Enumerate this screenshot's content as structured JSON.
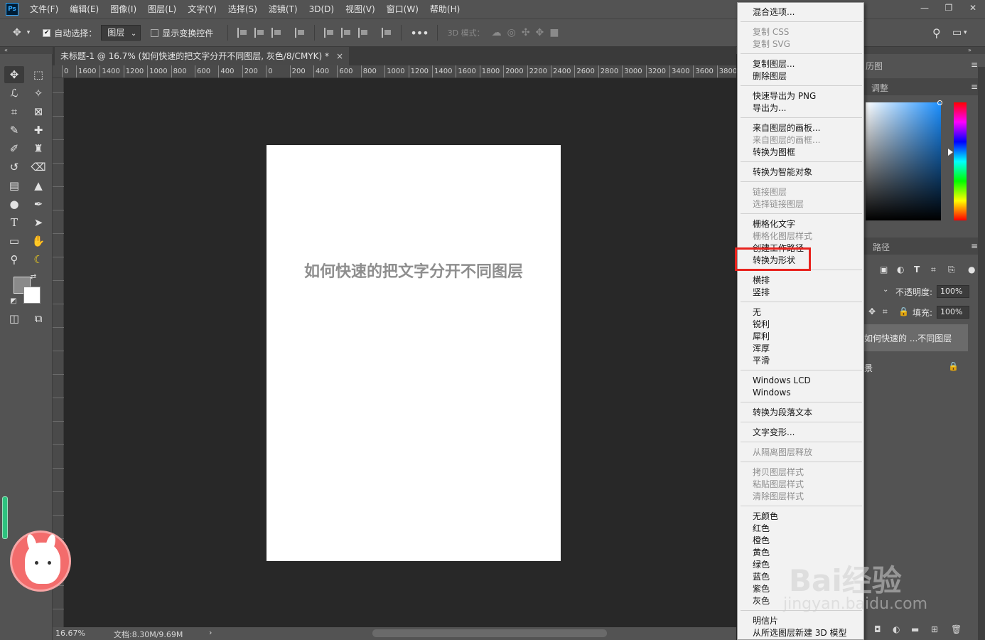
{
  "app": {
    "logo": "Ps"
  },
  "menubar": {
    "items": [
      "文件(F)",
      "编辑(E)",
      "图像(I)",
      "图层(L)",
      "文字(Y)",
      "选择(S)",
      "滤镜(T)",
      "3D(D)",
      "视图(V)",
      "窗口(W)",
      "帮助(H)"
    ]
  },
  "window_controls": {
    "minimize": "—",
    "restore": "❐",
    "close": "✕"
  },
  "optionsbar": {
    "auto_select_label": "自动选择：",
    "auto_select_value": "图层",
    "show_transform_label": "显示变换控件",
    "mode_3d_label": "3D 模式："
  },
  "document": {
    "tab_title": "未标题-1 @ 16.7% (如何快速的把文字分开不同图层, 灰色/8/CMYK) *",
    "close": "×",
    "text_layer_content": "如何快速的把文字分开不同图层"
  },
  "ruler": {
    "labels": [
      "0",
      "1600",
      "1400",
      "1200",
      "1000",
      "800",
      "600",
      "400",
      "200",
      "0",
      "200",
      "400",
      "600",
      "800",
      "1000",
      "1200",
      "1400",
      "1600",
      "1800",
      "2000",
      "2200",
      "2400",
      "2600",
      "2800",
      "3000",
      "3200",
      "3400",
      "3600",
      "3800"
    ]
  },
  "statusbar": {
    "zoom": "16.67%",
    "doc_size": "文档:8.30M/9.69M",
    "arrow": "›"
  },
  "right_panel": {
    "tab_layers_partial": "历图",
    "tab_adjust": "调整",
    "tab_paths": "路径",
    "opacity_label": "不透明度:",
    "opacity_value": "100%",
    "fill_label": "填充:",
    "fill_value": "100%",
    "active_layer_name": "如何快速的 ...不同图层",
    "bg_layer_partial": "景"
  },
  "context_menu": {
    "groups": [
      [
        {
          "label": "混合选项...",
          "enabled": true
        }
      ],
      [
        {
          "label": "复制 CSS",
          "enabled": false
        },
        {
          "label": "复制 SVG",
          "enabled": false
        }
      ],
      [
        {
          "label": "复制图层...",
          "enabled": true
        },
        {
          "label": "删除图层",
          "enabled": true
        }
      ],
      [
        {
          "label": "快速导出为 PNG",
          "enabled": true
        },
        {
          "label": "导出为...",
          "enabled": true
        }
      ],
      [
        {
          "label": "来自图层的画板...",
          "enabled": true
        },
        {
          "label": "来自图层的画框...",
          "enabled": false
        },
        {
          "label": "转换为图框",
          "enabled": true
        }
      ],
      [
        {
          "label": "转换为智能对象",
          "enabled": true
        }
      ],
      [
        {
          "label": "链接图层",
          "enabled": false
        },
        {
          "label": "选择链接图层",
          "enabled": false
        }
      ],
      [
        {
          "label": "栅格化文字",
          "enabled": true
        },
        {
          "label": "栅格化图层样式",
          "enabled": false
        },
        {
          "label": "创建工作路径",
          "enabled": true
        },
        {
          "label": "转换为形状",
          "enabled": true
        }
      ],
      [
        {
          "label": "横排",
          "enabled": true
        },
        {
          "label": "竖排",
          "enabled": true
        }
      ],
      [
        {
          "label": "无",
          "enabled": true
        },
        {
          "label": "锐利",
          "enabled": true
        },
        {
          "label": "犀利",
          "enabled": true
        },
        {
          "label": "浑厚",
          "enabled": true
        },
        {
          "label": "平滑",
          "enabled": true
        }
      ],
      [
        {
          "label": "Windows LCD",
          "enabled": true
        },
        {
          "label": "Windows",
          "enabled": true
        }
      ],
      [
        {
          "label": "转换为段落文本",
          "enabled": true
        }
      ],
      [
        {
          "label": "文字变形...",
          "enabled": true
        }
      ],
      [
        {
          "label": "从隔离图层释放",
          "enabled": false
        }
      ],
      [
        {
          "label": "拷贝图层样式",
          "enabled": false
        },
        {
          "label": "粘贴图层样式",
          "enabled": false
        },
        {
          "label": "清除图层样式",
          "enabled": false
        }
      ],
      [
        {
          "label": "无颜色",
          "enabled": true
        },
        {
          "label": "红色",
          "enabled": true
        },
        {
          "label": "橙色",
          "enabled": true
        },
        {
          "label": "黄色",
          "enabled": true
        },
        {
          "label": "绿色",
          "enabled": true
        },
        {
          "label": "蓝色",
          "enabled": true
        },
        {
          "label": "紫色",
          "enabled": true
        },
        {
          "label": "灰色",
          "enabled": true
        }
      ],
      [
        {
          "label": "明信片",
          "enabled": true
        },
        {
          "label": "从所选图层新建 3D 模型",
          "enabled": true
        }
      ]
    ],
    "highlighted_item": "转换为形状"
  },
  "watermark": {
    "brand": "Bai经验",
    "url": "jingyan.baidu.com"
  },
  "colors": {
    "ui_bg": "#535353",
    "canvas_bg": "#282828",
    "highlight": "#e8231e",
    "menu_bg": "#f2f2f2"
  }
}
